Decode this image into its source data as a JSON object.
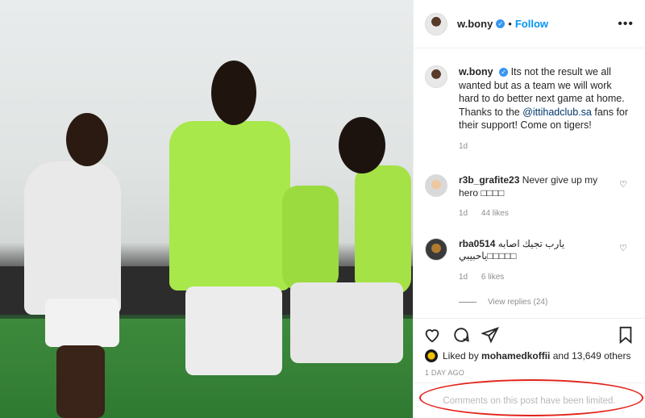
{
  "post": {
    "author": "w.bony",
    "follow_label": "Follow",
    "dot": "•",
    "more_label": "•••",
    "verified_glyph": "✓"
  },
  "caption": {
    "author": "w.bony",
    "text_before": "Its not the result we all wanted but as a team we will work hard to do better next game at home. Thanks to the ",
    "mention": "@ittihadclub.sa",
    "text_after": " fans for their support! Come on tigers!",
    "time": "1d"
  },
  "comments": [
    {
      "user": "r3b_grafite23",
      "text": "Never give up my hero □□□□",
      "time": "1d",
      "likes": "44 likes"
    },
    {
      "user": "rba0514",
      "text": "يارب تجيك اصابه ياحبيبي□□□□□",
      "time": "1d",
      "likes": "6 likes"
    }
  ],
  "view_replies": "View replies (24)",
  "likes": {
    "prefix": "Liked by",
    "user": "mohamedkoffii",
    "suffix": "and 13,649 others"
  },
  "date": "1 DAY AGO",
  "limited_notice": "Comments on this post have been limited.",
  "icons": [
    "heart-icon",
    "comment-icon",
    "share-icon",
    "bookmark-icon",
    "more-icon"
  ],
  "colors": {
    "link": "#0095f6",
    "verified": "#3897f0",
    "highlight": "#e2231a"
  }
}
